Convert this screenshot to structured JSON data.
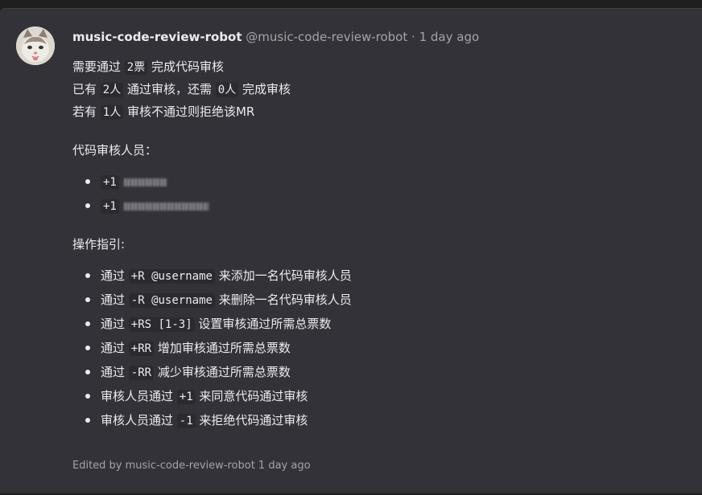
{
  "comment": {
    "author_name": "music-code-review-robot",
    "author_handle": "@music-code-review-robot",
    "separator": "·",
    "time": "1 day ago",
    "edited_text": "Edited by music-code-review-robot 1 day ago"
  },
  "body": {
    "line1": {
      "pre": "需要通过 ",
      "code": "2票",
      "post": " 完成代码审核"
    },
    "line2": {
      "pre": "已有 ",
      "code1": "2人",
      "mid": " 通过审核，还需 ",
      "code2": "0人",
      "post": " 完成审核"
    },
    "line3": {
      "pre": "若有 ",
      "code": "1人",
      "post": " 审核不通过则拒绝该MR"
    },
    "reviewers_title": "代码审核人员：",
    "reviewers": [
      {
        "vote": "+1"
      },
      {
        "vote": "+1"
      }
    ],
    "guide_title": "操作指引:",
    "guide": [
      {
        "pre": "通过 ",
        "code": "+R @username",
        "post": " 来添加一名代码审核人员"
      },
      {
        "pre": "通过 ",
        "code": "-R @username",
        "post": " 来删除一名代码审核人员"
      },
      {
        "pre": "通过 ",
        "code": "+RS [1-3]",
        "post": " 设置审核通过所需总票数"
      },
      {
        "pre": "通过 ",
        "code": "+RR",
        "post": " 增加审核通过所需总票数"
      },
      {
        "pre": "通过 ",
        "code": "-RR",
        "post": " 减少审核通过所需总票数"
      },
      {
        "pre": "审核人员通过 ",
        "code": "+1",
        "post": " 来同意代码通过审核"
      },
      {
        "pre": "审核人员通过 ",
        "code": "-1",
        "post": " 来拒绝代码通过审核"
      }
    ]
  },
  "icons": {
    "avatar": "cat-avatar-icon"
  }
}
